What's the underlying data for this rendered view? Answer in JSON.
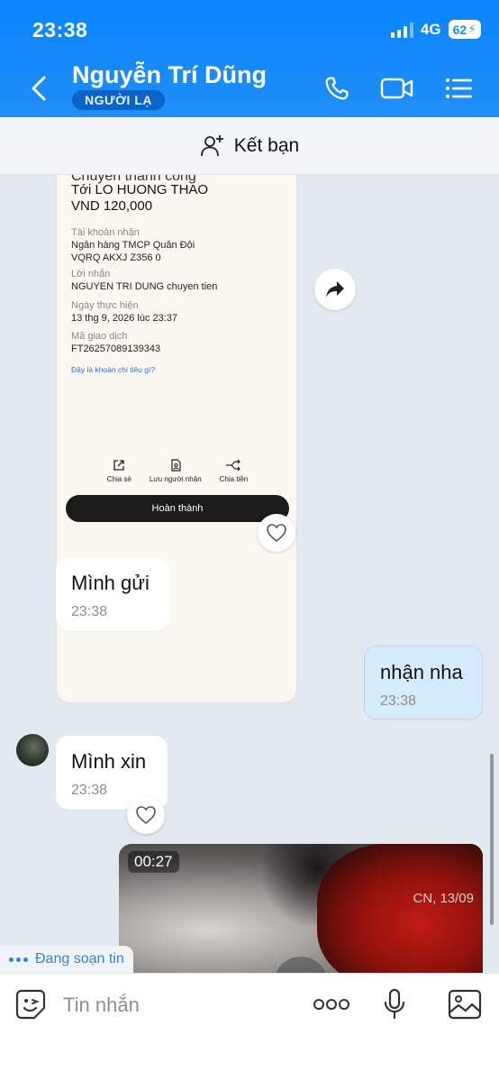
{
  "status_bar": {
    "time": "23:38",
    "network": "4G",
    "battery": "62"
  },
  "header": {
    "contact_name": "Nguyễn Trí Dũng",
    "badge": "NGƯỜI LẠ"
  },
  "friend_bar": {
    "label": "Kết bạn"
  },
  "receipt": {
    "cut_text": "Chuyển thành công",
    "to": "Tới LO HUONG THAO",
    "amount": "VND 120,000",
    "account_label": "Tài khoản nhận",
    "bank": "Ngân hàng TMCP Quân Đội",
    "account": "VQRQ AKXJ Z356 0",
    "message_label": "Lời nhắn",
    "message": "NGUYEN TRI DUNG chuyen tien",
    "date_label": "Ngày thực hiện",
    "date": "13 thg 9, 2026 lúc 23:37",
    "txn_label": "Mã giao dịch",
    "txn": "FT26257089139343",
    "link": "Đây là khoản chi tiêu gì?",
    "actions": [
      "Chia sẻ",
      "Lưu người nhận",
      "Chia tiền"
    ],
    "done_button": "Hoàn thành"
  },
  "messages": [
    {
      "text": "Mình gửi",
      "time": "23:38",
      "side": "left"
    },
    {
      "text": "nhận nha",
      "time": "23:38",
      "side": "right"
    },
    {
      "text": "Mình xin",
      "time": "23:38",
      "side": "left"
    }
  ],
  "video": {
    "duration": "00:27",
    "date": "CN, 13/09"
  },
  "typing": {
    "label": "Đang soạn tin"
  },
  "input": {
    "placeholder": "Tin nhắn"
  }
}
